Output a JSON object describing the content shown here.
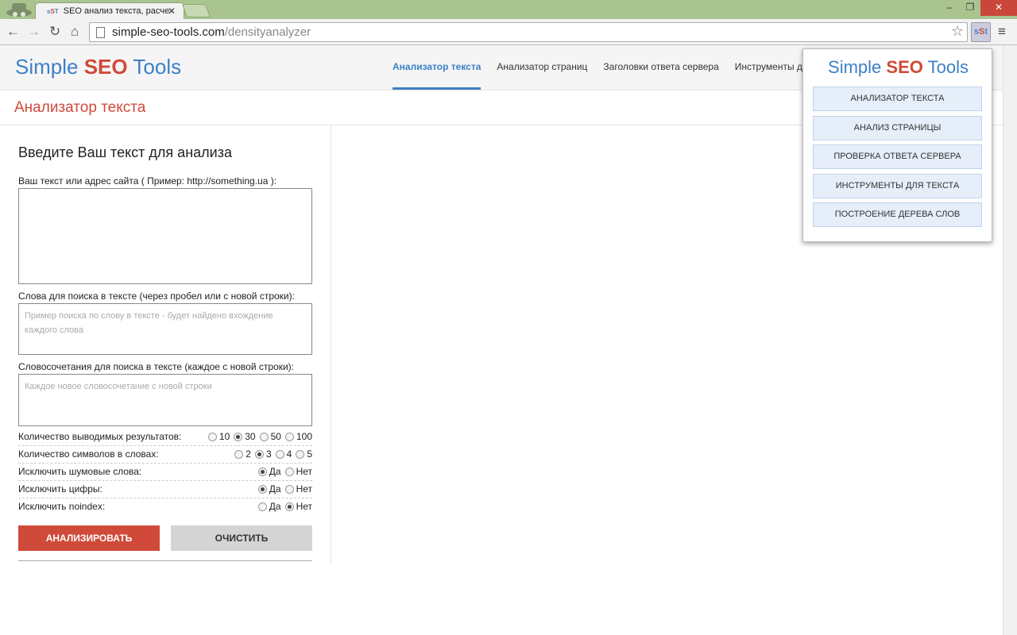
{
  "browser": {
    "tab_title": "SEO анализ текста, расче",
    "tab_favicon": "sST",
    "url_host": "simple-seo-tools.com",
    "url_path": "/densityanalyzer",
    "extension_label": "sSt"
  },
  "header": {
    "logo_simple": "Simple",
    "logo_seo": "SEO",
    "logo_tools": "Tools",
    "nav": [
      {
        "label": "Анализатор текста"
      },
      {
        "label": "Анализатор страниц"
      },
      {
        "label": "Заголовки ответа сервера"
      },
      {
        "label": "Инструменты д"
      }
    ]
  },
  "page": {
    "title": "Анализатор текста"
  },
  "form": {
    "heading": "Введите Ваш текст для анализа",
    "text_label": "Ваш текст или адрес сайта ( Пример: http://something.ua ):",
    "words_label": "Слова для поиска в тексте (через пробел или с новой строки):",
    "words_placeholder": "Пример поиска по слову в тексте - будет найдено вхождение каждого слова",
    "phrases_label": "Словосочетания для поиска в тексте (каждое с новой строки):",
    "phrases_placeholder": "Каждое новое словосочетание с новой строки",
    "options": [
      {
        "name": "Количество выводимых результатов:",
        "values": [
          "10",
          "30",
          "50",
          "100"
        ],
        "selected": "30"
      },
      {
        "name": "Количество символов в словах:",
        "values": [
          "2",
          "3",
          "4",
          "5"
        ],
        "selected": "3"
      },
      {
        "name": "Исключить шумовые слова:",
        "values": [
          "Да",
          "Нет"
        ],
        "selected": "Да"
      },
      {
        "name": "Исключить цифры:",
        "values": [
          "Да",
          "Нет"
        ],
        "selected": "Да"
      },
      {
        "name": "Исключить noindex:",
        "values": [
          "Да",
          "Нет"
        ],
        "selected": "Нет"
      }
    ],
    "analyze_label": "АНАЛИЗИРОВАТЬ",
    "clear_label": "ОЧИСТИТЬ"
  },
  "popup": {
    "logo_simple": "Simple",
    "logo_seo": "SEO",
    "logo_tools": "Tools",
    "items": [
      {
        "label": "АНАЛИЗАТОР ТЕКСТА"
      },
      {
        "label": "АНАЛИЗ СТРАНИЦЫ"
      },
      {
        "label": "ПРОВЕРКА ОТВЕТА СЕРВЕРА"
      },
      {
        "label": "ИНСТРУМЕНТЫ ДЛЯ ТЕКСТА"
      },
      {
        "label": "ПОСТРОЕНИЕ ДЕРЕВА СЛОВ"
      }
    ]
  },
  "colors": {
    "brand_blue": "#3d80c6",
    "brand_red": "#d04a3a",
    "titlebar": "#a9c48f"
  }
}
